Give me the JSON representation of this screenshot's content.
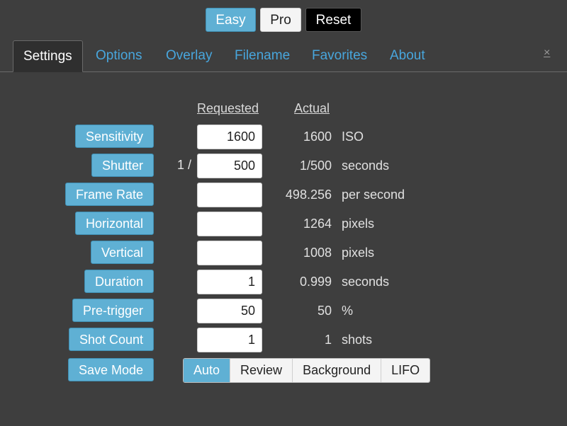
{
  "modes": {
    "easy": "Easy",
    "pro": "Pro",
    "reset": "Reset"
  },
  "tabs": [
    "Settings",
    "Options",
    "Overlay",
    "Filename",
    "Favorites",
    "About"
  ],
  "close": "×",
  "columns": {
    "requested": "Requested",
    "actual": "Actual"
  },
  "rows": [
    {
      "label": "Sensitivity",
      "prefix": "",
      "requested": "1600",
      "actual": "1600",
      "unit": "ISO"
    },
    {
      "label": "Shutter",
      "prefix": "1 /",
      "requested": "500",
      "actual": "1/500",
      "unit": "seconds"
    },
    {
      "label": "Frame Rate",
      "prefix": "",
      "requested": "",
      "actual": "498.256",
      "unit": "per second"
    },
    {
      "label": "Horizontal",
      "prefix": "",
      "requested": "",
      "actual": "1264",
      "unit": "pixels"
    },
    {
      "label": "Vertical",
      "prefix": "",
      "requested": "",
      "actual": "1008",
      "unit": "pixels"
    },
    {
      "label": "Duration",
      "prefix": "",
      "requested": "1",
      "actual": "0.999",
      "unit": "seconds"
    },
    {
      "label": "Pre-trigger",
      "prefix": "",
      "requested": "50",
      "actual": "50",
      "unit": "%"
    },
    {
      "label": "Shot Count",
      "prefix": "",
      "requested": "1",
      "actual": "1",
      "unit": "shots"
    }
  ],
  "save_mode": {
    "label": "Save Mode",
    "options": [
      "Auto",
      "Review",
      "Background",
      "LIFO"
    ],
    "selected": "Auto"
  },
  "colors": {
    "accent": "#5fb0d4",
    "link": "#48a6dd",
    "background": "#3e3e3e"
  }
}
